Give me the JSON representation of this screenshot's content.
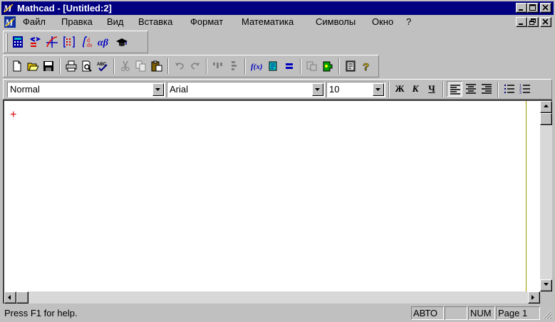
{
  "window": {
    "title": "Mathcad  - [Untitled:2]",
    "app_icon": "mathcad-icon"
  },
  "menu": {
    "items": [
      "Файл",
      "Правка",
      "Вид",
      "Вставка",
      "Формат",
      "Математика",
      "Символы",
      "Окно",
      "?"
    ]
  },
  "math_palette": {
    "buttons": [
      "calculator-palette-icon",
      "evaluation-palette-icon",
      "graph-palette-icon",
      "matrix-palette-icon",
      "calculus-palette-icon",
      "greek-palette-icon",
      "symbolic-palette-icon"
    ]
  },
  "standard_toolbar": {
    "buttons": [
      "new-icon",
      "open-icon",
      "save-icon",
      "print-icon",
      "print-preview-icon",
      "spell-check-icon",
      "cut-icon",
      "copy-icon",
      "paste-icon",
      "undo-icon",
      "redo-icon",
      "align-top-icon",
      "align-down-icon",
      "insert-function-icon",
      "insert-unit-icon",
      "calculate-icon",
      "resource-icon",
      "component-icon",
      "electronic-book-icon",
      "help-icon"
    ]
  },
  "format_toolbar": {
    "style_value": "Normal",
    "font_value": "Arial",
    "size_value": "10",
    "bold_label": "Ж",
    "italic_label": "К",
    "underline_label": "Ч"
  },
  "colors": {
    "titlebar": "#000080",
    "caret": "#e00000",
    "margin_line": "#999900"
  },
  "status": {
    "help_text": "Press F1 for help.",
    "mode": "АВТО",
    "num": "NUM",
    "page": "Page 1"
  }
}
